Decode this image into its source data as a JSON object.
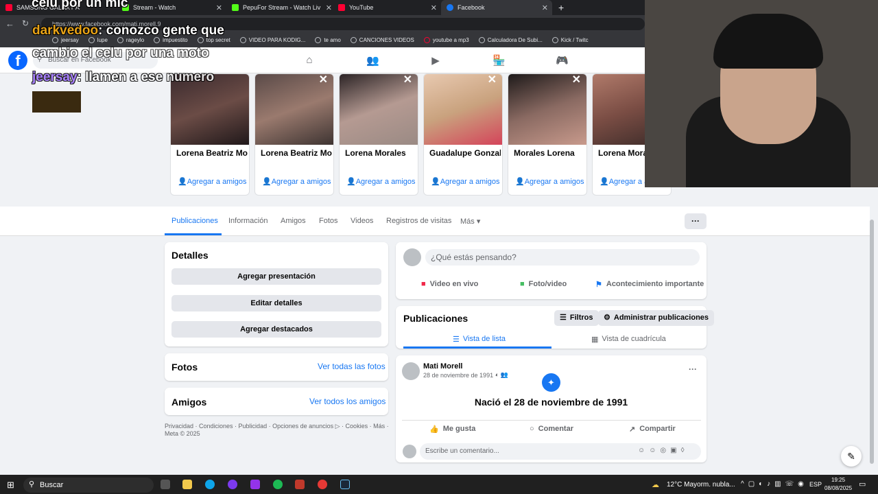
{
  "browser": {
    "tabs": [
      {
        "label": "SAMSUNG GALAXY A",
        "color": "#ff0033"
      },
      {
        "label": "pe",
        "color": "#53fc18"
      },
      {
        "label": "Stream - Watch",
        "color": "#53fc18"
      },
      {
        "label": "PepuFor Stream - Watch Liv",
        "color": "#53fc18"
      },
      {
        "label": "YouTube",
        "color": "#ff0033"
      },
      {
        "label": "Facebook",
        "color": "#1877f2"
      }
    ],
    "new_tab": "+",
    "url": "https://www.facebook.com/mati.morell.9",
    "bookmarks": [
      "jeersay",
      "lupe",
      "rageylo",
      "impuestito",
      "top secret",
      "VIDEO PARA KODIG...",
      "te amo",
      "CANCIONES VIDEOS",
      "youtube a mp3",
      "Calculadora De Subi...",
      "Kick / Twitc"
    ]
  },
  "overlay": {
    "line1": "celu por un mic",
    "line2_user": "darkvedoo",
    "line2_text": ": conozco gente que",
    "line3": "cambio el celu por una moto",
    "line4_user": "jeersay",
    "line4_text": ": llamen a ese numero"
  },
  "fb": {
    "logo": "f",
    "search_placeholder": "Buscar en Facebook",
    "suggestions": [
      {
        "name": "Lorena Beatriz Mora",
        "action": "Agregar a amigos",
        "photo": "#6b4c46"
      },
      {
        "name": "Lorena Beatriz Mora",
        "action": "Agregar a amigos",
        "photo": "#9a7a6e"
      },
      {
        "name": "Lorena Morales",
        "action": "Agregar a amigos",
        "photo": "#b59a92"
      },
      {
        "name": "Guadalupe Gonzale",
        "action": "Agregar a amigos",
        "photo": "#c9a27e"
      },
      {
        "name": "Morales Lorena",
        "action": "Agregar a amigos",
        "photo": "#8a6a62"
      },
      {
        "name": "Lorena Morale",
        "action": "Agregar a a",
        "photo": "#7a4d44"
      }
    ],
    "profile_tabs": [
      "Publicaciones",
      "Información",
      "Amigos",
      "Fotos",
      "Videos",
      "Registros de visitas",
      "Más ▾"
    ],
    "more_dots": "···",
    "details": {
      "title": "Detalles",
      "buttons": [
        "Agregar presentación",
        "Editar detalles",
        "Agregar destacados"
      ]
    },
    "photos": {
      "title": "Fotos",
      "link": "Ver todas las fotos"
    },
    "friends": {
      "title": "Amigos",
      "link": "Ver todos los amigos"
    },
    "footer": "Privacidad · Condiciones · Publicidad · Opciones de anuncios ▷ · Cookies · Más ·",
    "footer2": "Meta © 2025",
    "composer": {
      "placeholder": "¿Qué estás pensando?",
      "actions": [
        "Video en vivo",
        "Foto/video",
        "Acontecimiento importante"
      ]
    },
    "posts_header": {
      "title": "Publicaciones",
      "filters": "Filtros",
      "manage": "Administrar publicaciones",
      "list_view": "Vista de lista",
      "grid_view": "Vista de cuadrícula"
    },
    "post": {
      "author": "Mati Morell",
      "date": "28 de noviembre de 1991 ·",
      "event": "Nació el 28 de noviembre de 1991",
      "like": "Me gusta",
      "comment": "Comentar",
      "share": "Compartir",
      "comment_placeholder": "Escribe un comentario..."
    }
  },
  "taskbar": {
    "search": "Buscar",
    "weather": "12°C  Mayorm. nubla...",
    "lang": "ESP",
    "time": "19:25",
    "date": "08/08/2025"
  }
}
